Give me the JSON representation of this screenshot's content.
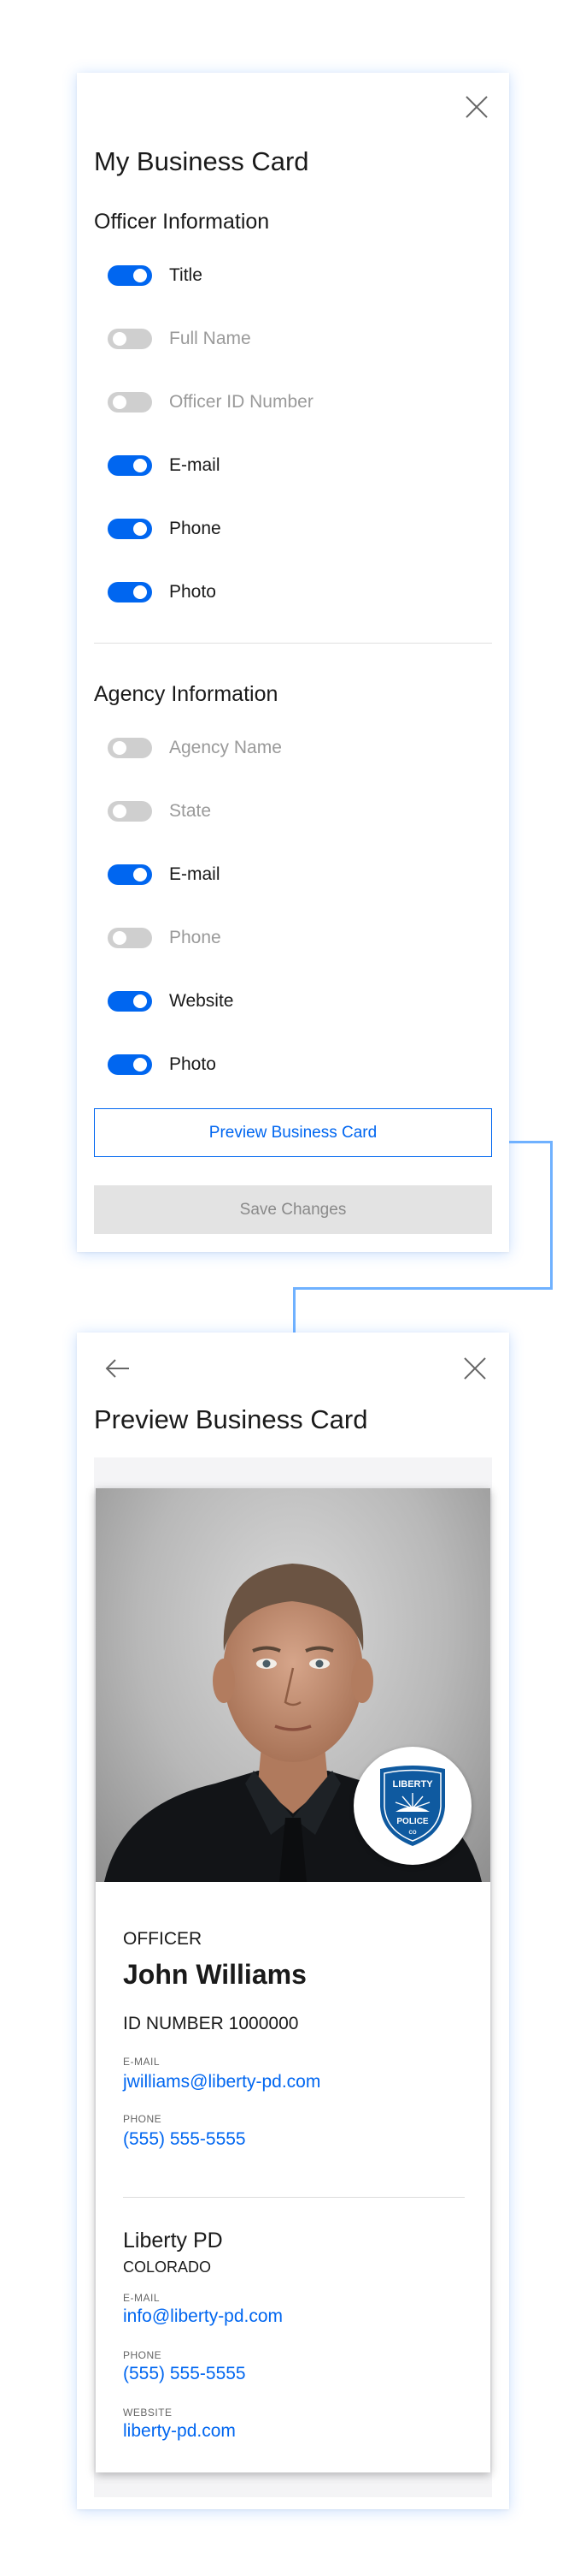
{
  "settings": {
    "title": "My Business Card",
    "officer_section_title": "Officer Information",
    "officer_items": [
      {
        "label": "Title",
        "on": true
      },
      {
        "label": "Full Name",
        "on": false
      },
      {
        "label": "Officer ID Number",
        "on": false
      },
      {
        "label": "E-mail",
        "on": true
      },
      {
        "label": "Phone",
        "on": true
      },
      {
        "label": "Photo",
        "on": true
      }
    ],
    "agency_section_title": "Agency Information",
    "agency_items": [
      {
        "label": "Agency Name",
        "on": false
      },
      {
        "label": "State",
        "on": false
      },
      {
        "label": "E-mail",
        "on": true
      },
      {
        "label": "Phone",
        "on": false
      },
      {
        "label": "Website",
        "on": true
      },
      {
        "label": "Photo",
        "on": true
      }
    ],
    "preview_button": "Preview Business Card",
    "save_button": "Save Changes"
  },
  "preview": {
    "title": "Preview Business Card",
    "card": {
      "rank": "OFFICER",
      "name": "John Williams",
      "id_number": "ID NUMBER 1000000",
      "email_label": "E-MAIL",
      "email": "jwilliams@liberty-pd.com",
      "phone_label": "PHONE",
      "phone": "(555) 555-5555",
      "agency_name": "Liberty PD",
      "agency_state": "COLORADO",
      "agency_email_label": "E-MAIL",
      "agency_email": "info@liberty-pd.com",
      "agency_phone_label": "PHONE",
      "agency_phone": "(555) 555-5555",
      "website_label": "WEBSITE",
      "website": "liberty-pd.com",
      "badge": {
        "top": "LIBERTY",
        "middle": "POLICE",
        "bottom": "CO"
      }
    }
  },
  "colors": {
    "accent": "#0066f0",
    "toggle_off": "#cfcfcf",
    "connector": "#6fb1ff",
    "badge_blue": "#0f5aa0"
  },
  "icons": {
    "close": "close-icon",
    "back": "arrow-left-icon",
    "badge": "police-badge-icon"
  }
}
